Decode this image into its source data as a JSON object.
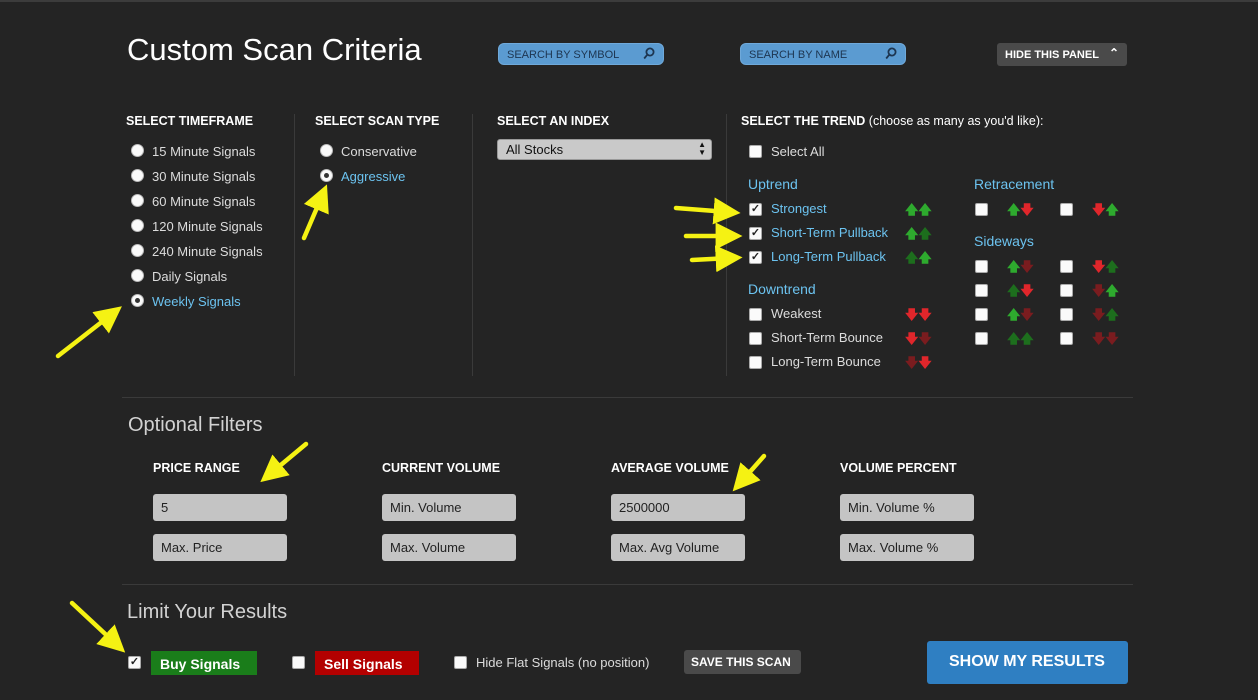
{
  "header": {
    "title": "Custom Scan Criteria",
    "search_symbol": "SEARCH BY SYMBOL",
    "search_name": "SEARCH BY NAME",
    "hide_panel": "HIDE THIS PANEL"
  },
  "timeframe": {
    "heading": "SELECT TIMEFRAME",
    "options": [
      {
        "label": "15 Minute Signals",
        "selected": false
      },
      {
        "label": "30 Minute Signals",
        "selected": false
      },
      {
        "label": "60 Minute Signals",
        "selected": false
      },
      {
        "label": "120 Minute Signals",
        "selected": false
      },
      {
        "label": "240 Minute Signals",
        "selected": false
      },
      {
        "label": "Daily Signals",
        "selected": false
      },
      {
        "label": "Weekly Signals",
        "selected": true
      }
    ]
  },
  "scan_type": {
    "heading": "SELECT SCAN TYPE",
    "options": [
      {
        "label": "Conservative",
        "selected": false
      },
      {
        "label": "Aggressive",
        "selected": true
      }
    ]
  },
  "index": {
    "heading": "SELECT AN INDEX",
    "selected": "All Stocks"
  },
  "trend": {
    "heading": "SELECT THE TREND",
    "heading_note": "(choose as many as you'd like):",
    "select_all": "Select All",
    "uptrend_label": "Uptrend",
    "uptrend": [
      {
        "label": "Strongest",
        "checked": true
      },
      {
        "label": "Short-Term Pullback",
        "checked": true
      },
      {
        "label": "Long-Term Pullback",
        "checked": true
      }
    ],
    "downtrend_label": "Downtrend",
    "downtrend": [
      {
        "label": "Weakest",
        "checked": false
      },
      {
        "label": "Short-Term Bounce",
        "checked": false
      },
      {
        "label": "Long-Term Bounce",
        "checked": false
      }
    ],
    "retracement_label": "Retracement",
    "sideways_label": "Sideways"
  },
  "filters": {
    "heading": "Optional Filters",
    "price_range": {
      "label": "PRICE RANGE",
      "min_value": "5",
      "max_placeholder": "Max. Price"
    },
    "current_volume": {
      "label": "CURRENT VOLUME",
      "min_placeholder": "Min. Volume",
      "max_placeholder": "Max. Volume"
    },
    "average_volume": {
      "label": "AVERAGE VOLUME",
      "min_value": "2500000",
      "max_placeholder": "Max. Avg Volume"
    },
    "volume_percent": {
      "label": "VOLUME PERCENT",
      "min_placeholder": "Min. Volume %",
      "max_placeholder": "Max. Volume %"
    }
  },
  "limit": {
    "heading": "Limit Your Results",
    "buy_signals": "Buy Signals",
    "buy_checked": true,
    "sell_signals": "Sell Signals",
    "sell_checked": false,
    "hide_flat": "Hide Flat Signals (no position)",
    "hide_flat_checked": false,
    "save_scan": "SAVE THIS SCAN",
    "show_results": "SHOW MY RESULTS"
  },
  "colors": {
    "background": "#242424",
    "link_blue": "#6cc3f0",
    "buy_green": "#1a7d1a",
    "sell_red": "#b30000",
    "button_blue": "#2f7fc2",
    "annotation_yellow": "#f5f213"
  },
  "icons": {
    "search": "magnifier-icon",
    "up_arrow": "up-arrow-icon",
    "down_arrow": "down-arrow-icon"
  }
}
